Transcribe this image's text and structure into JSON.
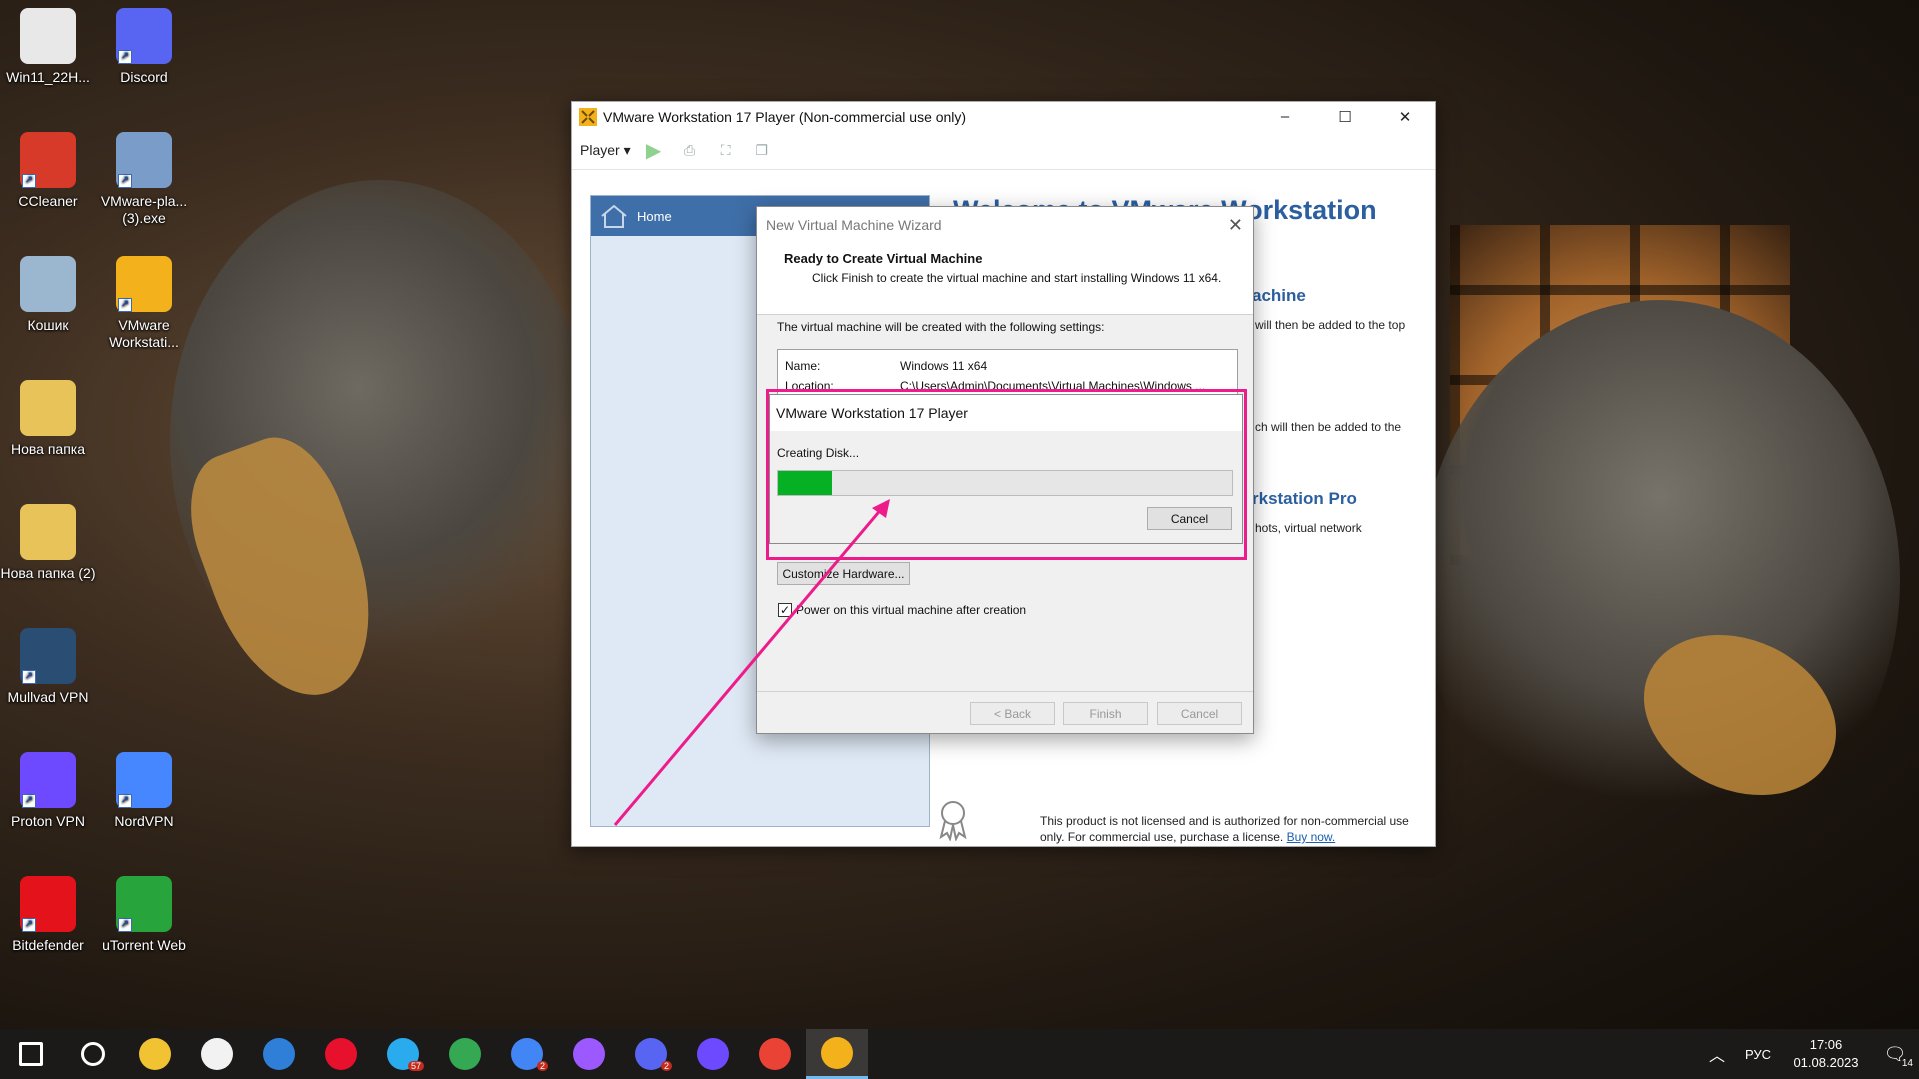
{
  "desktop": {
    "icons": [
      {
        "label": "Win11_22H...",
        "icon": "disc-image-icon",
        "color": "#e8e8e8"
      },
      {
        "label": "Discord",
        "icon": "discord-icon",
        "color": "#5865f2"
      },
      {
        "label": "CCleaner",
        "icon": "ccleaner-icon",
        "color": "#d83a2a"
      },
      {
        "label": "VMware-pla... (3).exe",
        "icon": "installer-icon",
        "color": "#7a9cc9"
      },
      {
        "label": "Кошик",
        "icon": "recycle-bin-icon",
        "color": "#9bb6cf"
      },
      {
        "label": "VMware Workstati...",
        "icon": "vmware-icon",
        "color": "#f3b21b"
      },
      {
        "label": "Нова папка",
        "icon": "folder-icon",
        "color": "#e8c35a"
      },
      {
        "label": "Нова папка (2)",
        "icon": "folder-icon",
        "color": "#e8c35a"
      },
      {
        "label": "Mullvad VPN",
        "icon": "mullvad-icon",
        "color": "#294d73"
      },
      {
        "label": "Proton VPN",
        "icon": "protonvpn-icon",
        "color": "#6d4aff"
      },
      {
        "label": "NordVPN",
        "icon": "nordvpn-icon",
        "color": "#4687ff"
      },
      {
        "label": "Bitdefender",
        "icon": "bitdefender-icon",
        "color": "#e3121b"
      },
      {
        "label": "uTorrent Web",
        "icon": "utorrent-icon",
        "color": "#27a43b"
      }
    ]
  },
  "vmware": {
    "title": "VMware Workstation 17 Player (Non-commercial use only)",
    "minimize": "–",
    "maximize": "☐",
    "close": "✕",
    "player_menu": "Player",
    "home_label": "Home",
    "welcome_title": "Welcome to VMware Workstation",
    "sub1": "achine",
    "txt1": "will then be added to the top",
    "txt2": "ch will then be added to the",
    "sub2": "rkstation Pro",
    "txt3": "hots, virtual network",
    "license_text": "This product is not licensed and is authorized for non-commercial use only. For commercial use, purchase a license.",
    "buy_now": "Buy now."
  },
  "wizard": {
    "title": "New Virtual Machine Wizard",
    "close": "✕",
    "heading": "Ready to Create Virtual Machine",
    "description": "Click Finish to create the virtual machine and start installing Windows 11 x64.",
    "settings_label": "The virtual machine will be created with the following settings:",
    "settings": [
      {
        "key": "Name:",
        "value": "Windows 11 x64"
      },
      {
        "key": "Location:",
        "value": "C:\\Users\\Admin\\Documents\\Virtual Machines\\Windows ..."
      }
    ],
    "customize_button": "Customize Hardware...",
    "power_on_label": "Power on this virtual machine after creation",
    "power_on_checked": "✓",
    "back_button": "< Back",
    "finish_button": "Finish",
    "cancel_button": "Cancel"
  },
  "progress": {
    "title": "VMware Workstation 17 Player",
    "status": "Creating Disk...",
    "percent": 12,
    "cancel_button": "Cancel"
  },
  "taskbar": {
    "apps": [
      {
        "icon": "start-icon",
        "color": "#ffffff"
      },
      {
        "icon": "search-icon",
        "color": "#ffffff"
      },
      {
        "icon": "file-explorer-icon",
        "color": "#f1c232"
      },
      {
        "icon": "store-icon",
        "color": "#f2f2f2"
      },
      {
        "icon": "mail-icon",
        "color": "#2f7fd9"
      },
      {
        "icon": "opera-icon",
        "color": "#e8112d"
      },
      {
        "icon": "telegram-icon",
        "color": "#2aabee",
        "badge": "57"
      },
      {
        "icon": "chrome-icon",
        "color": "#34a853"
      },
      {
        "icon": "chrome-profile-icon",
        "color": "#4285f4",
        "badge": "2"
      },
      {
        "icon": "drop-app-icon",
        "color": "#9b59ff"
      },
      {
        "icon": "discord-taskbar-icon",
        "color": "#5865f2",
        "badge": "2"
      },
      {
        "icon": "vpn-check-icon",
        "color": "#6d4aff"
      },
      {
        "icon": "chrome-alt-icon",
        "color": "#ea4335"
      },
      {
        "icon": "vmware-taskbar-icon",
        "color": "#f3b21b"
      }
    ],
    "language": "РУС",
    "time": "17:06",
    "date": "01.08.2023",
    "notifications": "14"
  }
}
